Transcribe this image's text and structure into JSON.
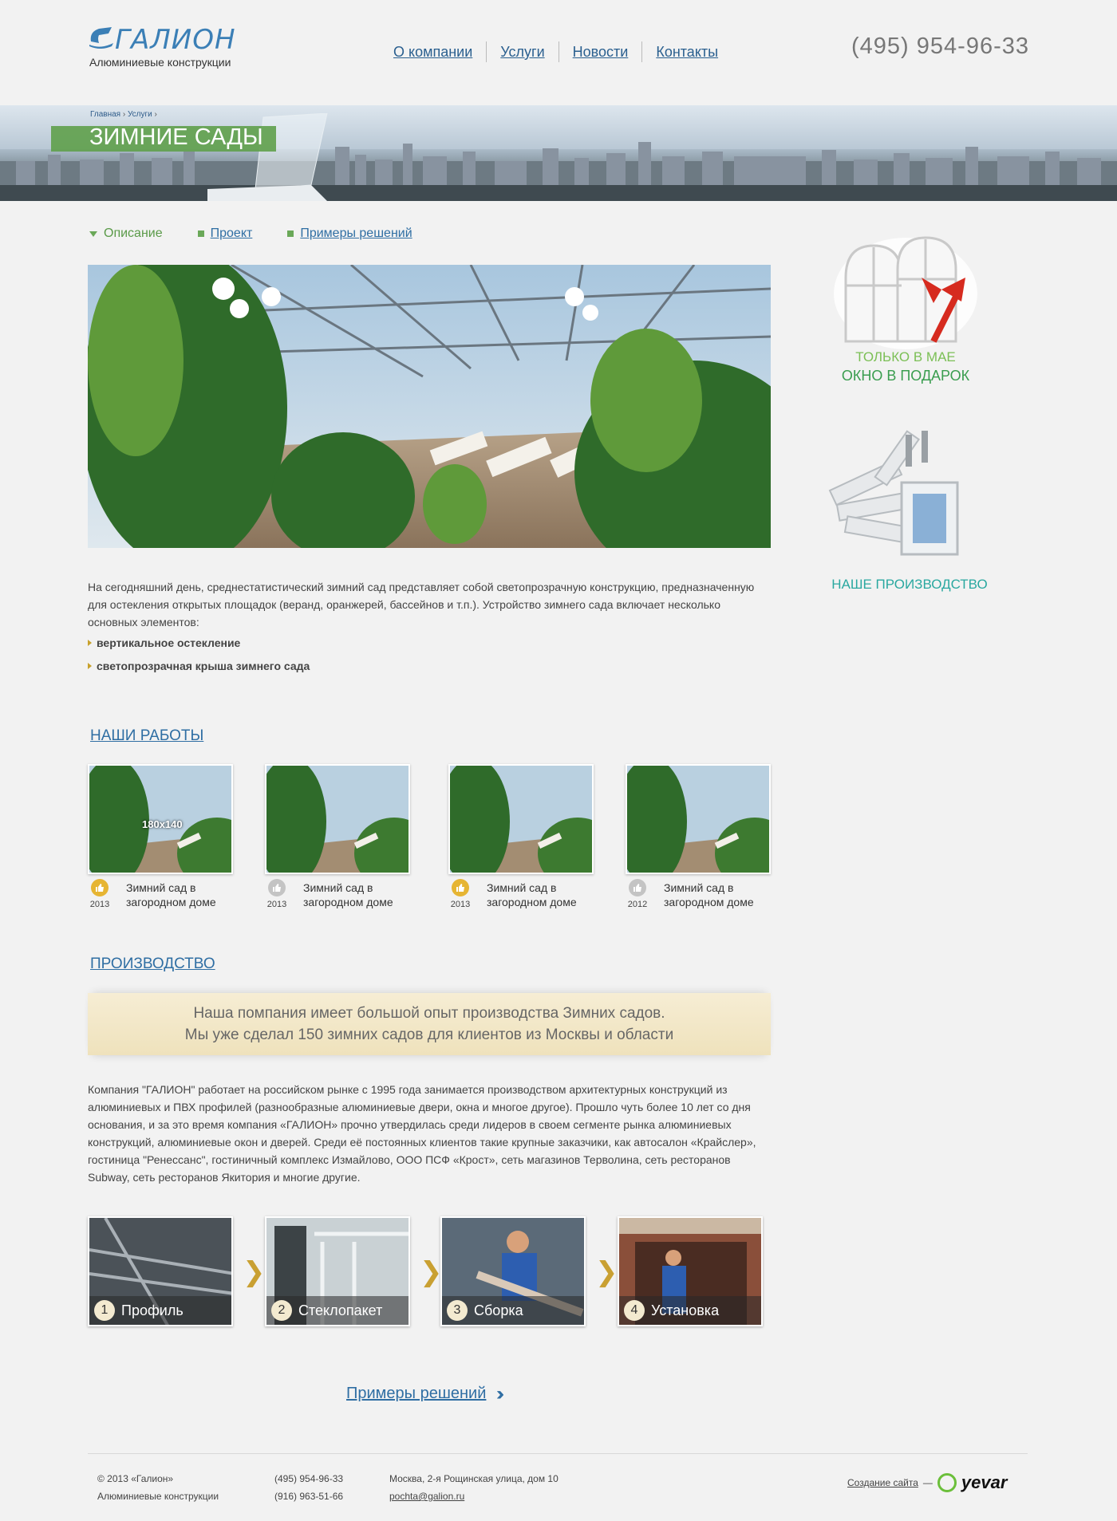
{
  "header": {
    "logo_title": "ГАЛИОН",
    "logo_subtitle": "Алюминиевые конструкции",
    "nav": [
      "О компании",
      "Услуги",
      "Новости",
      "Контакты"
    ],
    "phone": "(495) 954-96-33"
  },
  "banner": {
    "breadcrumb": [
      "Главная",
      "Услуги"
    ],
    "title": "ЗИМНИЕ САДЫ"
  },
  "tabs": [
    {
      "label": "Описание",
      "active": true
    },
    {
      "label": "Проект",
      "active": false
    },
    {
      "label": "Примеры решений",
      "active": false
    }
  ],
  "intro": {
    "text": "На сегодняшний день, среднестатистический зимний сад представляет собой светопрозрачную конструкцию, предназначенную для остекления открытых площадок (веранд, оранжерей, бассейнов и т.п.). Устройство зимнего сада включает несколько основных элементов:",
    "bullets": [
      "вертикальное остекление",
      "светопрозрачная крыша зимнего сада"
    ]
  },
  "works": {
    "title": "НАШИ РАБОТЫ",
    "thumb_label": "180x140",
    "items": [
      {
        "year": "2013",
        "caption": "Зимний сад в загородном доме",
        "badge": "gold"
      },
      {
        "year": "2013",
        "caption": "Зимний сад в загородном доме",
        "badge": "grey"
      },
      {
        "year": "2013",
        "caption": "Зимний сад в загородном доме",
        "badge": "gold"
      },
      {
        "year": "2012",
        "caption": "Зимний сад в загородном доме",
        "badge": "grey"
      }
    ]
  },
  "production": {
    "title": "ПРОИЗВОДСТВО",
    "quote_line1": "Наша помпания имеет большой опыт производства Зимних садов.",
    "quote_line2": "Мы уже сделал 150 зимних садов для клиентов из Москвы и области",
    "text": "Компания \"ГАЛИОН\" работает на российском рынке с 1995 года занимается производством архитектурных конструкций из алюминиевых и ПВХ профилей (разнообразные алюминиевые двери, окна и многое другое). Прошло чуть более 10 лет со дня основания, и за это время компания «ГАЛИОН» прочно утвердилась среди лидеров в своем сегменте рынка алюминиевых конструкций, алюминиевые окон и дверей. Среди её постоянных клиентов такие крупные заказчики, как автосалон «Крайслер», гостиница \"Ренессанс\", гостиничный комплекс Измайлово, ООО ПСФ «Крост», сеть магазинов Терволина, сеть ресторанов Subway, сеть ресторанов Якитория и многие другие.",
    "steps": [
      {
        "num": "1",
        "name": "Профиль"
      },
      {
        "num": "2",
        "name": "Стеклопакет"
      },
      {
        "num": "3",
        "name": "Сборка"
      },
      {
        "num": "4",
        "name": "Установка"
      }
    ],
    "more_link": "Примеры решений"
  },
  "sidebar": {
    "promo1_line1": "ТОЛЬКО В МАЕ",
    "promo1_line2": "ОКНО В ПОДАРОК",
    "promo2": "НАШЕ ПРОИЗВОДСТВО"
  },
  "footer": {
    "copyright": "© 2013  «Галион»",
    "company": "Алюминиевые конструкции",
    "phone1": "(495) 954-96-33",
    "phone2": "(916) 963-51-66",
    "address": "Москва, 2-я Рощинская улица, дом 10",
    "email": "pochta@galion.ru",
    "dev_link": "Создание сайта",
    "dev_sep": "—",
    "dev_brand": "yevar"
  },
  "colors": {
    "accent_blue": "#2f6ea3",
    "green": "#5a9a48",
    "gold": "#c9a032"
  }
}
